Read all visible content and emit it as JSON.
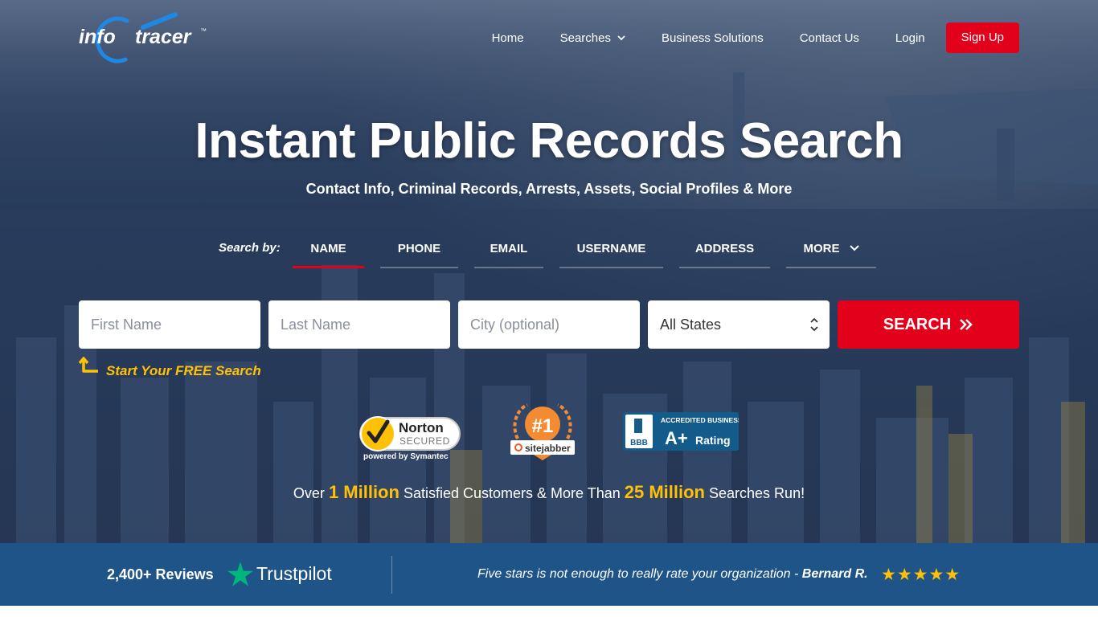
{
  "brand": {
    "logo_info": "info",
    "logo_tracer": "tracer",
    "logo_tm": "™"
  },
  "nav": {
    "home": "Home",
    "searches": "Searches",
    "business": "Business Solutions",
    "contact": "Contact Us",
    "login": "Login",
    "signup": "Sign Up"
  },
  "hero": {
    "title": "Instant Public Records Search",
    "subtitle": "Contact Info, Criminal Records, Arrests, Assets, Social Profiles & More"
  },
  "search": {
    "search_by_label": "Search by:",
    "tabs": [
      "NAME",
      "PHONE",
      "EMAIL",
      "USERNAME",
      "ADDRESS",
      "MORE"
    ],
    "active_tab": "NAME",
    "first_name_placeholder": "First Name",
    "last_name_placeholder": "Last Name",
    "city_placeholder": "City (optional)",
    "state_selected": "All States",
    "button_label": "SEARCH",
    "free_cta": "Start Your FREE Search"
  },
  "badges": {
    "norton_name": "Norton",
    "norton_secured": "SECURED",
    "norton_powered": "powered by Symantec",
    "sitejabber_rank": "#1",
    "sitejabber_name": "sitejabber",
    "bbb_top": "ACCREDITED BUSINESS",
    "bbb_grade": "A+",
    "bbb_rating": "Rating",
    "bbb_logo": "BBB"
  },
  "stats": {
    "prefix": "Over",
    "customers": "1 Million",
    "middle": "Satisfied Customers & More Than",
    "searches": "25 Million",
    "suffix": "Searches Run!"
  },
  "footer": {
    "reviews": "2,400+ Reviews",
    "trustpilot": "Trustpilot",
    "quote": "Five stars is not enough to really rate your organization -",
    "author": "Bernard R.",
    "stars": "★★★★★"
  },
  "colors": {
    "accent_red": "#e3001b",
    "highlight_yellow": "#ffc107",
    "footer_blue": "#1e5487",
    "trustpilot_green": "#00b67a"
  },
  "icons": {
    "searches": "chevron-down-icon",
    "more": "chevron-down-icon",
    "search_button": "double-chevron-right-icon",
    "free_cta": "curved-arrow-icon",
    "state_select": "updown-chevron-icon",
    "trustpilot": "star-icon"
  }
}
